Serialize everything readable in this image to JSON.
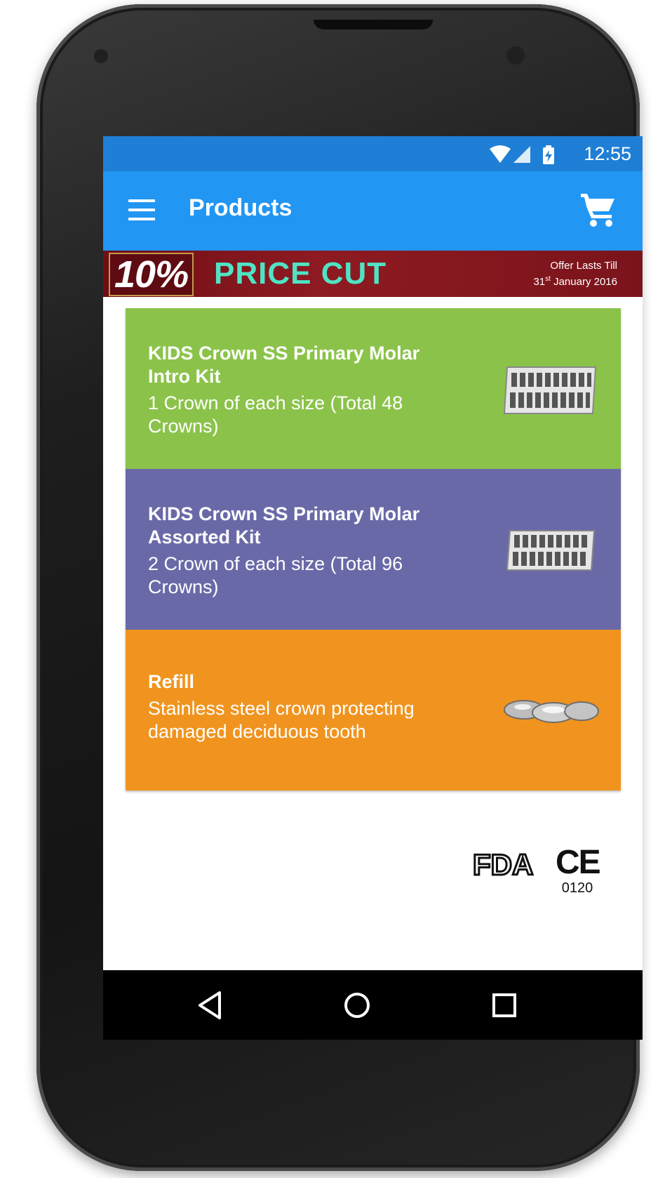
{
  "status_bar": {
    "time": "12:55",
    "icons": [
      "wifi-icon",
      "cell-signal-icon",
      "battery-charging-icon"
    ]
  },
  "app_bar": {
    "title": "Products",
    "menu_icon": "menu-icon",
    "cart_icon": "cart-icon",
    "color": "#2196f3"
  },
  "banner": {
    "percent": "10%",
    "headline": "PRICE CUT",
    "offer_line1": "Offer Lasts Till",
    "offer_day": "31",
    "offer_suffix": "st",
    "offer_rest": " January 2016"
  },
  "products": [
    {
      "title": "KIDS Crown SS Primary Molar Intro Kit",
      "description": "1 Crown of each size (Total 48 Crowns)",
      "color": "#8bc34a",
      "image": "crown-tray-kit"
    },
    {
      "title": "KIDS Crown SS Primary Molar Assorted Kit",
      "description": "2 Crown of each size (Total 96 Crowns)",
      "color": "#6a69a8",
      "image": "crown-tray-kit"
    },
    {
      "title": "Refill",
      "description": "Stainless steel crown protecting damaged deciduous tooth",
      "color": "#f0941f",
      "image": "steel-crowns"
    }
  ],
  "certifications": {
    "fda": "FDA",
    "ce": "CE",
    "ce_number": "0120"
  },
  "nav_bar": {
    "icons": [
      "back-icon",
      "home-icon",
      "recents-icon"
    ]
  }
}
